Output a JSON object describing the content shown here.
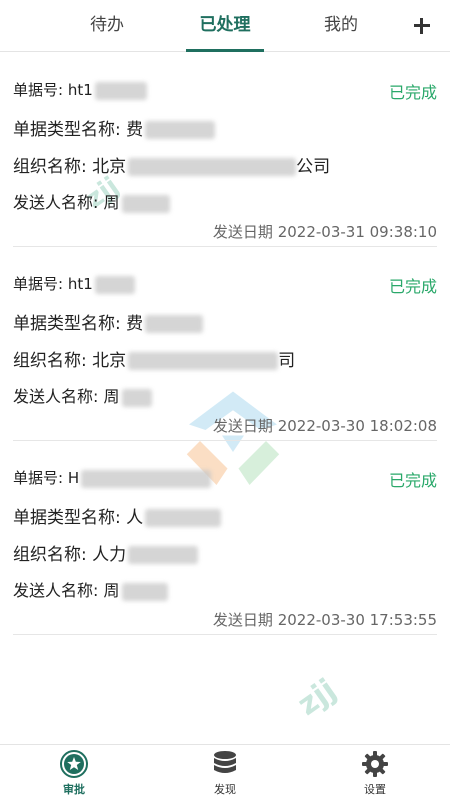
{
  "tabs": [
    {
      "label": "待办"
    },
    {
      "label": "已处理"
    },
    {
      "label": "我的"
    }
  ],
  "active_tab": "已处理",
  "accent_color": "#1f6f5f",
  "status_color": "#2aa86a",
  "records": [
    {
      "doc_no_label": "单据号:",
      "doc_no_value": "ht1",
      "type_label": "单据类型名称:",
      "type_value": "费",
      "org_label": "组织名称:",
      "org_value_start": "北京",
      "org_value_end": "公司",
      "sender_label": "发送人名称:",
      "sender_value": "周",
      "status": "已完成",
      "send_date": "发送日期 2022-03-31 09:38:10"
    },
    {
      "doc_no_label": "单据号:",
      "doc_no_value": "ht1",
      "type_label": "单据类型名称:",
      "type_value": "费",
      "org_label": "组织名称:",
      "org_value_start": "北京",
      "org_value_end": "司",
      "sender_label": "发送人名称:",
      "sender_value": "周",
      "status": "已完成",
      "send_date": "发送日期 2022-03-30 18:02:08"
    },
    {
      "doc_no_label": "单据号:",
      "doc_no_value": "H",
      "type_label": "单据类型名称:",
      "type_value": "人",
      "org_label": "组织名称:",
      "org_value_start": "人力",
      "org_value_end": "",
      "sender_label": "发送人名称:",
      "sender_value": "周",
      "status": "已完成",
      "send_date": "发送日期 2022-03-30 17:53:55"
    }
  ],
  "watermark": "zjj",
  "bottom_nav": [
    {
      "label": "审批",
      "icon": "approval-badge-icon"
    },
    {
      "label": "发现",
      "icon": "database-icon"
    },
    {
      "label": "设置",
      "icon": "gear-icon"
    }
  ]
}
